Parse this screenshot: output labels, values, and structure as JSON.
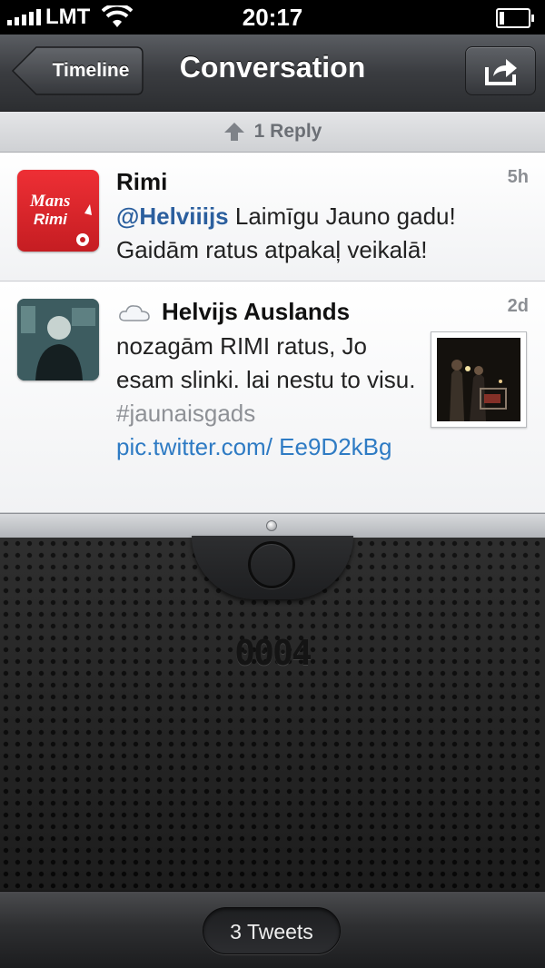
{
  "status_bar": {
    "carrier": "LMT",
    "time": "20:17",
    "battery_level": 0.15
  },
  "nav": {
    "back_label": "Timeline",
    "title": "Conversation"
  },
  "reply_strip": {
    "label": "1 Reply"
  },
  "tweets": [
    {
      "author": "Rimi",
      "time": "5h",
      "mention": "@Helviiijs",
      "text": " Laimīgu Jauno gadu! Gaidām ratus atpakaļ veikalā!",
      "avatar_text_1": "Mans",
      "avatar_text_2": "Rimi"
    },
    {
      "author": "Helvijs Auslands",
      "time": "2d",
      "text": "nozagām RIMI ratus, Jo esam slinki. lai nestu to visu. ",
      "hashtag": "#jaunaisgads",
      "link": "pic.twitter.com/ Ee9D2kBg"
    }
  ],
  "grille": {
    "counter": "0004"
  },
  "bottom": {
    "tweets_count_label": "3 Tweets"
  },
  "colors": {
    "mention": "#2b5f9e",
    "link": "#2e7bc4",
    "hashtag": "#8e9196",
    "rimi_red": "#e0282e"
  }
}
